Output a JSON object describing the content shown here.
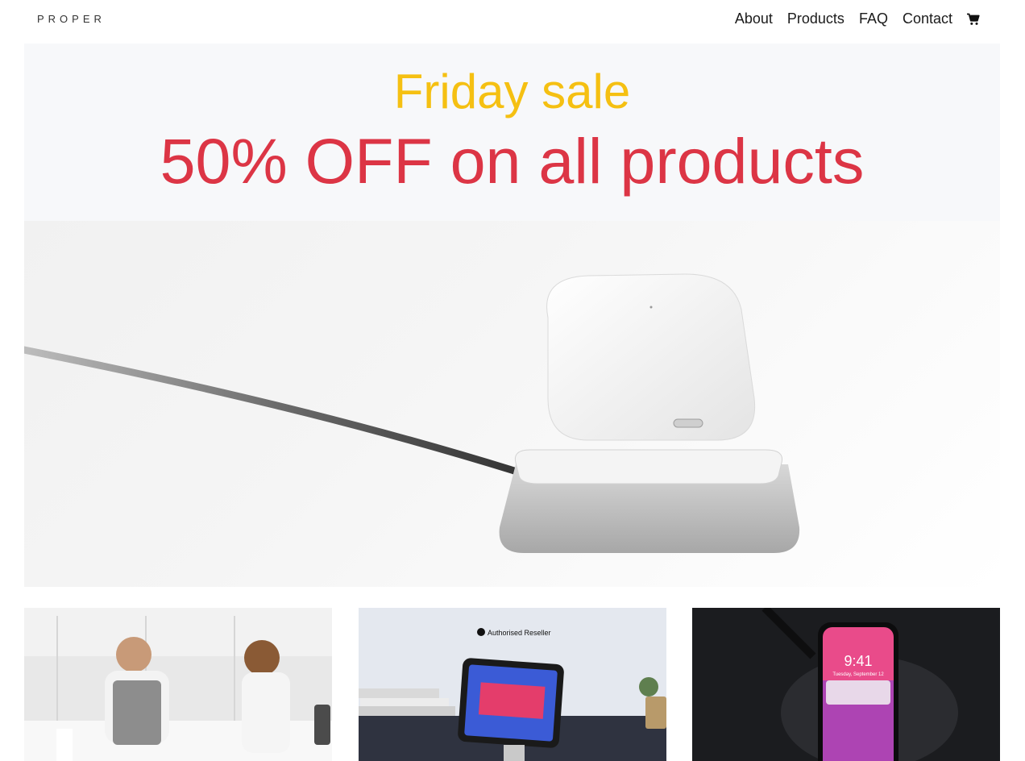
{
  "brand": {
    "logo_text": "PROPER"
  },
  "nav": {
    "items": [
      {
        "label": "About"
      },
      {
        "label": "Products"
      },
      {
        "label": "FAQ"
      },
      {
        "label": "Contact"
      }
    ],
    "cart_icon": "shopping-cart-icon"
  },
  "promo": {
    "subtitle": "Friday sale",
    "headline": "50% OFF on all products",
    "colors": {
      "subtitle": "#f5c012",
      "headline": "#dc3545",
      "background": "#f7f8fa"
    }
  },
  "hero": {
    "image": "airpods-wireless-charging-dock-photo"
  },
  "products": [
    {
      "image": "baristas-coffee-bar-photo"
    },
    {
      "image": "ipad-stand-authorised-reseller-photo",
      "overlay_text": "Authorised Reseller"
    },
    {
      "image": "iphone-wireless-charger-photo",
      "time_text": "9:41",
      "date_text": "Tuesday, September 12"
    }
  ]
}
